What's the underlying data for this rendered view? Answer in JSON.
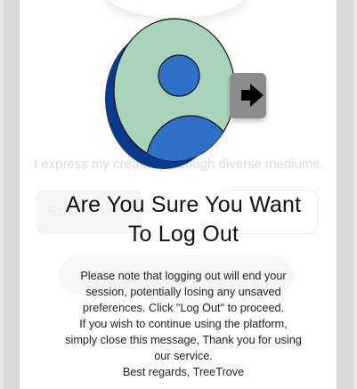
{
  "background": {
    "bio_text": "I express my creativity through diverse mediums.",
    "edit_button_label": "Edit",
    "bottom_mark": "TreeTrove"
  },
  "dialog": {
    "title": "Are You Sure You Want To Log Out",
    "message_lines": [
      "Please note that logging out will end your",
      "session, potentially losing any unsaved",
      "preferences. Click \"Log Out\" to proceed.",
      "If you wish to continue using the platform,",
      "simply close this message, Thank you for using",
      "our service.",
      "Best regards, TreeTrove"
    ]
  },
  "icons": {
    "avatar": "user-avatar-icon",
    "logout": "logout-arrow-icon"
  },
  "colors": {
    "avatar_fill": "#a8d5ba",
    "avatar_figure": "#2d6fc9",
    "avatar_shadow": "#0a3a8c",
    "logout_bg": "#8c8c8c"
  }
}
